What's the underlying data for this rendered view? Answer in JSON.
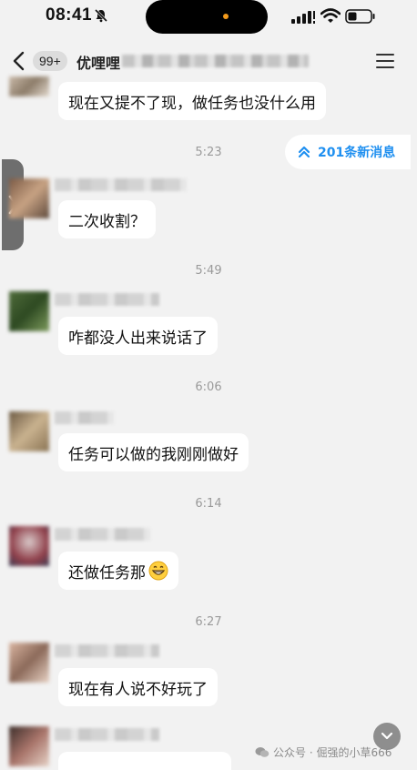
{
  "status_bar": {
    "time": "08:41"
  },
  "header": {
    "unread_count": "99+",
    "group_name": "优哩哩"
  },
  "new_messages": {
    "label": "201条新消息"
  },
  "messages": [
    {
      "kind": "bubble",
      "text": "现在又提不了现，做任务也没什么用"
    },
    {
      "kind": "time",
      "text": "5:23"
    },
    {
      "kind": "bubble",
      "text": "二次收割？"
    },
    {
      "kind": "time",
      "text": "5:49"
    },
    {
      "kind": "bubble",
      "text": "咋都没人出来说话了"
    },
    {
      "kind": "time",
      "text": "6:06"
    },
    {
      "kind": "bubble",
      "text": "任务可以做的我刚刚做好"
    },
    {
      "kind": "time",
      "text": "6:14"
    },
    {
      "kind": "bubble",
      "text": "还做任务那",
      "emoji": "grinning-face"
    },
    {
      "kind": "time",
      "text": "6:27"
    },
    {
      "kind": "bubble",
      "text": "现在有人说不好玩了"
    }
  ],
  "watermark": {
    "text": "公众号 · 倔强的小草666"
  },
  "colors": {
    "background": "#f2f2f2",
    "accent": "#1e8ff0",
    "bubble": "#ffffff",
    "timestamp": "#9a9a9a"
  }
}
